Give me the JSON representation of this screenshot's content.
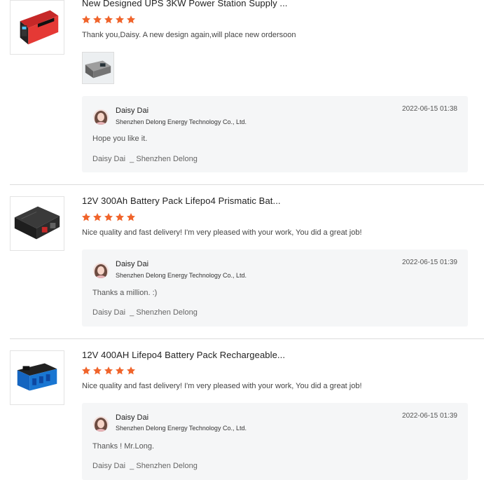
{
  "theme": {
    "star_color": "#f0642b",
    "reply_bg": "#f5f6f7"
  },
  "reviews": [
    {
      "product_title": "New Designed UPS 3KW Power Station Supply ...",
      "rating": 5,
      "comment": "Thank you,Daisy. A new design again,will place new ordersoon",
      "has_photo": true,
      "reply": {
        "name": "Daisy Dai",
        "company": "Shenzhen Delong Energy Technology Co., Ltd.",
        "date": "2022-06-15 01:38",
        "text": "Hope you like it.",
        "signature": "Daisy Dai  _ Shenzhen Delong"
      }
    },
    {
      "product_title": "12V 300Ah Battery Pack Lifepo4 Prismatic Bat...",
      "rating": 5,
      "comment": "Nice quality and fast delivery! I'm very pleased with your work,  You did a great job!",
      "has_photo": false,
      "reply": {
        "name": "Daisy Dai",
        "company": "Shenzhen Delong Energy Technology Co., Ltd.",
        "date": "2022-06-15 01:39",
        "text": "Thanks a million. :)",
        "signature": "Daisy Dai  _ Shenzhen Delong"
      }
    },
    {
      "product_title": "12V 400AH Lifepo4 Battery Pack Rechargeable...",
      "rating": 5,
      "comment": "Nice quality and fast delivery! I'm very pleased with your work,  You did a great job!",
      "has_photo": false,
      "reply": {
        "name": "Daisy Dai",
        "company": "Shenzhen Delong Energy Technology Co., Ltd.",
        "date": "2022-06-15 01:39",
        "text": "Thanks ! Mr.Long.",
        "signature": "Daisy Dai  _ Shenzhen Delong"
      }
    }
  ]
}
